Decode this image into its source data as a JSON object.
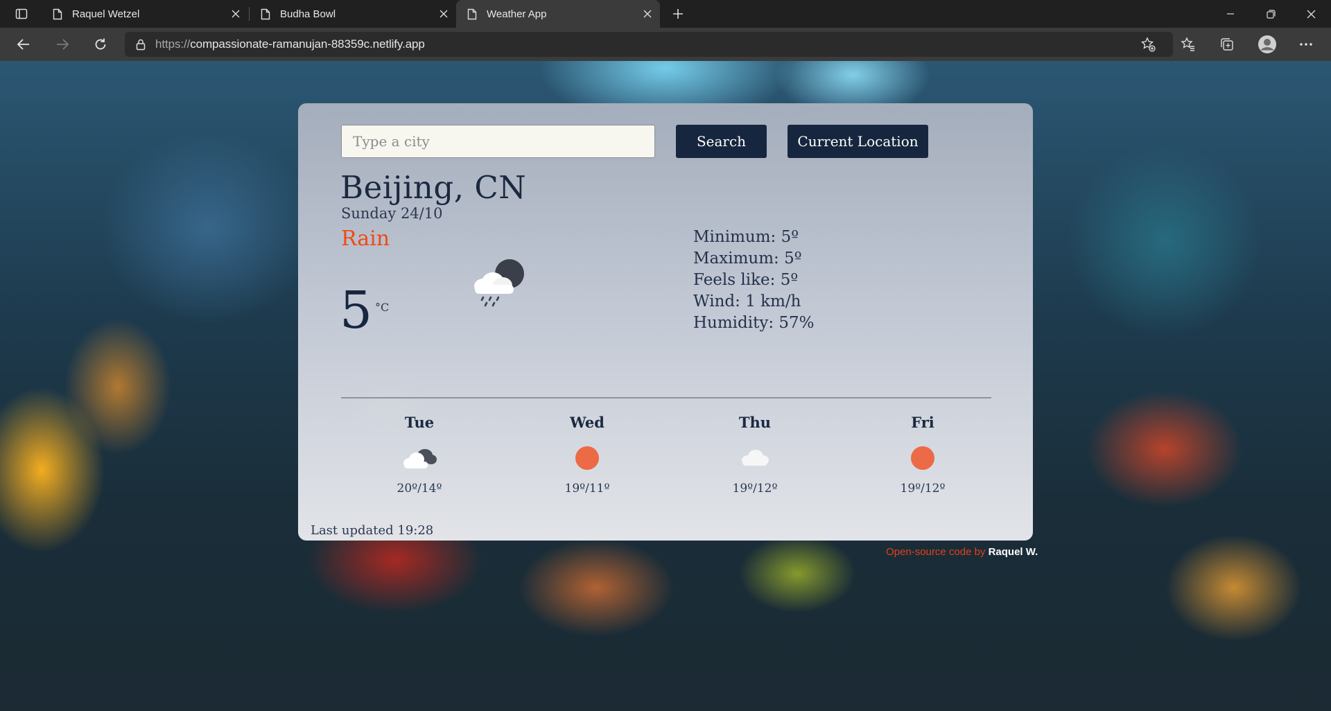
{
  "browser": {
    "tabs": [
      {
        "title": "Raquel Wetzel"
      },
      {
        "title": "Budha Bowl"
      },
      {
        "title": "Weather App"
      }
    ],
    "url_protocol": "https://",
    "url_host": "compassionate-ramanujan-88359c.netlify.app"
  },
  "search": {
    "placeholder": "Type a city",
    "search_label": "Search",
    "location_label": "Current Location"
  },
  "current": {
    "city": "Beijing, CN",
    "date": "Sunday 24/10",
    "description": "Rain",
    "temperature": "5",
    "unit": "°C",
    "icon": "night-rain-cloud-icon"
  },
  "details": {
    "minimum": "Minimum: 5º",
    "maximum": "Maximum: 5º",
    "feels_like": "Feels like: 5º",
    "wind": "Wind: 1 km/h",
    "humidity": "Humidity: 57%"
  },
  "forecast": [
    {
      "day": "Tue",
      "range": "20º/14º",
      "icon": "partly-cloudy-night-icon"
    },
    {
      "day": "Wed",
      "range": "19º/11º",
      "icon": "sun-icon"
    },
    {
      "day": "Thu",
      "range": "19º/12º",
      "icon": "cloud-icon"
    },
    {
      "day": "Fri",
      "range": "19º/12º",
      "icon": "sun-icon"
    }
  ],
  "footer": {
    "last_updated": "Last updated 19:28",
    "credit_prefix": "Open-source code by",
    "credit_author": "Raquel W."
  },
  "colors": {
    "accent": "#f04a14",
    "button": "#17263f",
    "sun": "#ec6a45"
  }
}
